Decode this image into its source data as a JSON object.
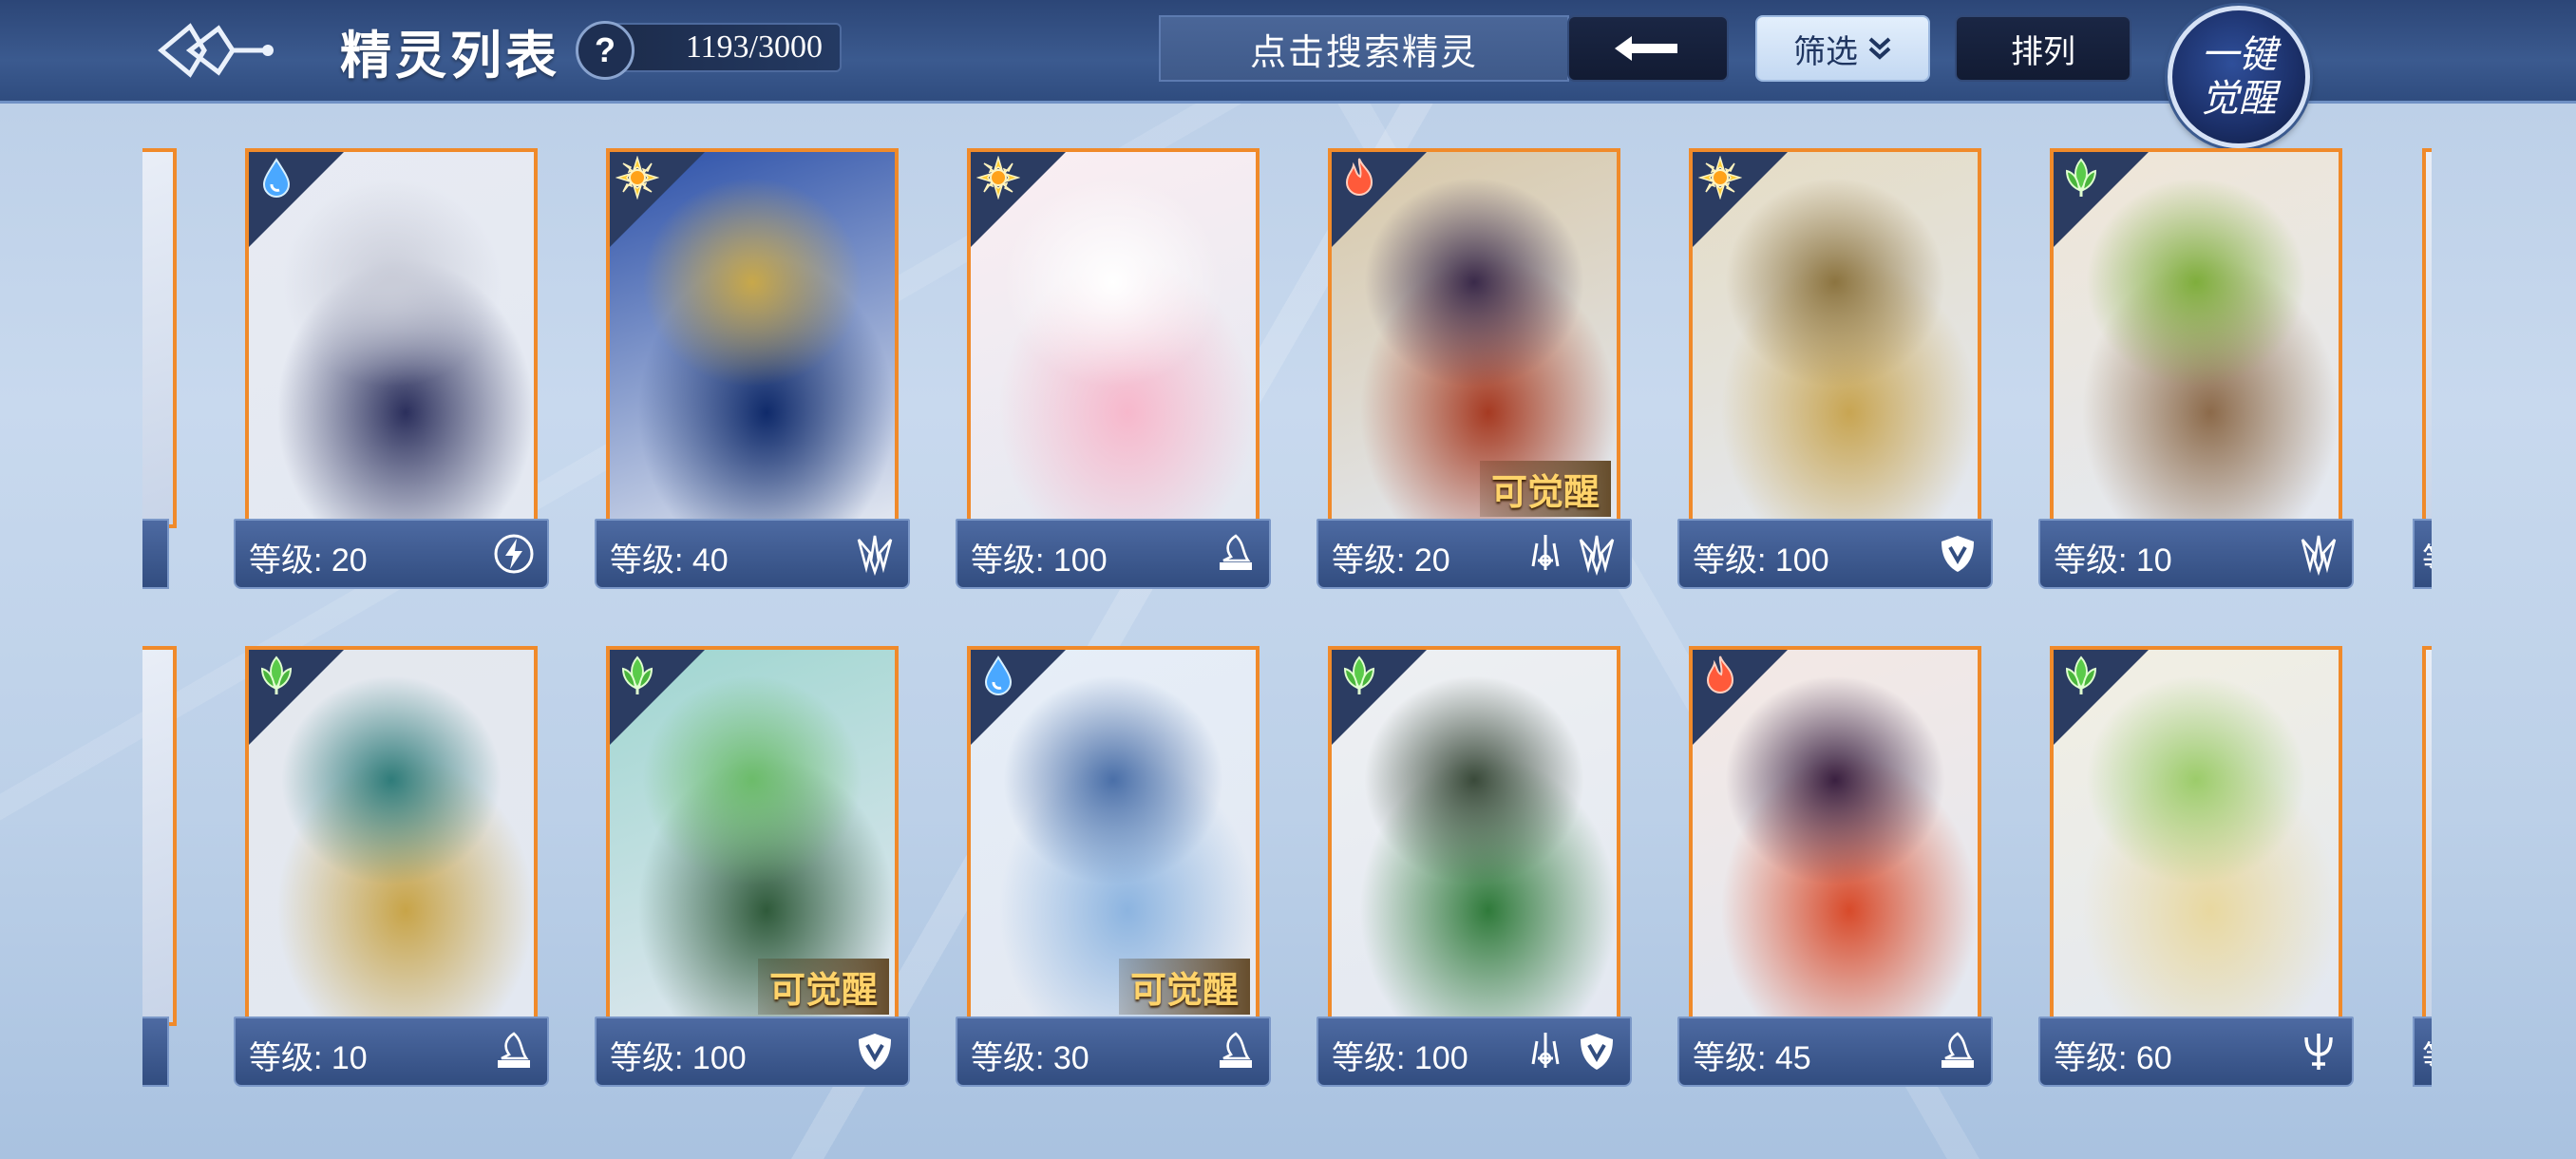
{
  "header": {
    "title": "精灵列表",
    "help": "?",
    "count": "1193/3000",
    "search_placeholder": "点击搜索精灵",
    "back_icon": "arrow-left-icon",
    "filter_label": "筛选",
    "sort_label": "排列",
    "awaken_line1": "一键",
    "awaken_line2": "觉醒"
  },
  "colors": {
    "topbar": "#2f4c7f",
    "card_border": "#f08a2a",
    "level_bar": "#324d80",
    "awaken_text": "#ffd36a"
  },
  "cards": [
    {
      "level": "等级: 20",
      "element": "water",
      "classes": [
        "lightning-icon"
      ],
      "awaken": "",
      "art": [
        "#e8ebf3",
        "#2b2f5c",
        "#c9ccd8"
      ]
    },
    {
      "level": "等级: 40",
      "element": "sun",
      "classes": [
        "claw-icon"
      ],
      "awaken": "",
      "art": [
        "#2a4fa8",
        "#0f2a6a",
        "#c8a84a"
      ]
    },
    {
      "level": "等级: 100",
      "element": "sun",
      "classes": [
        "book-icon"
      ],
      "awaken": "",
      "art": [
        "#fbeef2",
        "#f7b8cc",
        "#ffffff"
      ]
    },
    {
      "level": "等级: 20",
      "element": "fire",
      "classes": [
        "sword-icon",
        "claw-icon"
      ],
      "awaken": "可觉醒",
      "art": [
        "#d8c8a8",
        "#a63a22",
        "#3a2a4a"
      ]
    },
    {
      "level": "等级: 100",
      "element": "sun",
      "classes": [
        "shield-icon"
      ],
      "awaken": "",
      "art": [
        "#e5dcc4",
        "#c8a552",
        "#8c7440"
      ]
    },
    {
      "level": "等级: 10",
      "element": "leaf",
      "classes": [
        "claw-icon"
      ],
      "awaken": "",
      "art": [
        "#efe6d6",
        "#8c6a4a",
        "#7fae3c"
      ]
    },
    {
      "level": "等级: 10",
      "element": "leaf",
      "classes": [
        "book-icon"
      ],
      "awaken": "",
      "art": [
        "#e4e8ee",
        "#c8a448",
        "#2f7c7a"
      ]
    },
    {
      "level": "等级: 100",
      "element": "leaf",
      "classes": [
        "shield-icon"
      ],
      "awaken": "可觉醒",
      "art": [
        "#9fd6d0",
        "#2f5a3a",
        "#6cbc6a"
      ]
    },
    {
      "level": "等级: 30",
      "element": "water",
      "classes": [
        "book-icon"
      ],
      "awaken": "可觉醒",
      "art": [
        "#e6eef8",
        "#8cb4e0",
        "#4a6fa8"
      ]
    },
    {
      "level": "等级: 100",
      "element": "leaf",
      "classes": [
        "sword-icon",
        "shield-icon"
      ],
      "awaken": "",
      "art": [
        "#eef0f2",
        "#2f7a3a",
        "#3a4a3a"
      ]
    },
    {
      "level": "等级: 45",
      "element": "fire",
      "classes": [
        "book-icon"
      ],
      "awaken": "",
      "art": [
        "#f4e8e4",
        "#d84a2a",
        "#3a2040"
      ]
    },
    {
      "level": "等级: 60",
      "element": "leaf",
      "classes": [
        "trident-icon"
      ],
      "awaken": "",
      "art": [
        "#f2efe2",
        "#e8d8a0",
        "#9ccc6a"
      ]
    }
  ],
  "edge_left_level": "",
  "edge_right_level": "等"
}
